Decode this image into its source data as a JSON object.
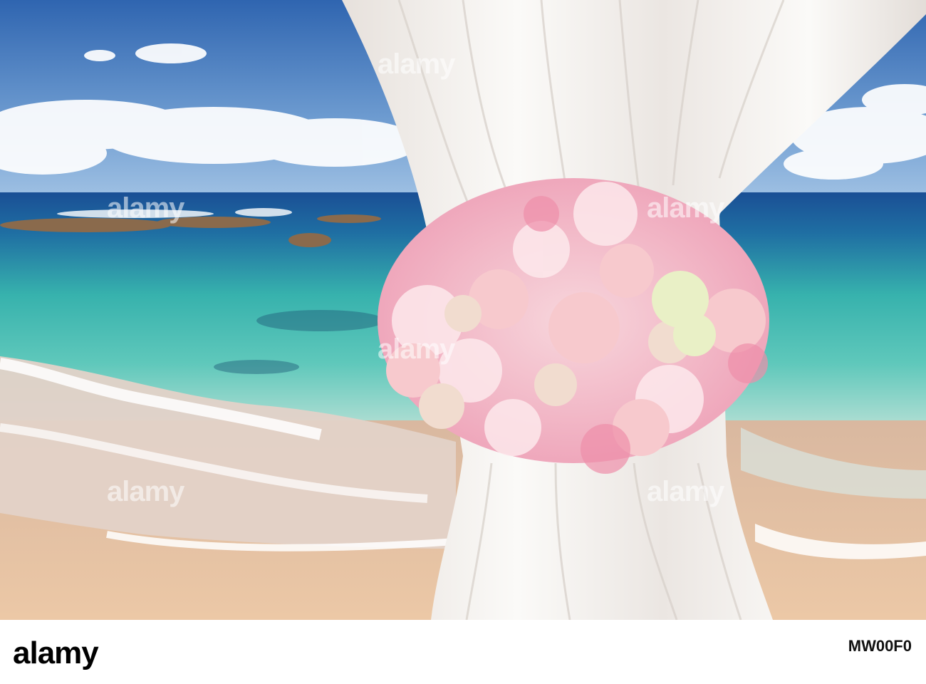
{
  "footer": {
    "brand": "alamy",
    "image_id_value": "MW00F0"
  },
  "watermarks": [
    "alamy",
    "alamy",
    "alamy",
    "alamy",
    "alamy",
    "alamy"
  ],
  "colors": {
    "sky": "#3f74b8",
    "sea_deep": "#1f5fa0",
    "sea_turquoise": "#3fc0b0",
    "sand": "#e6c6a8",
    "curtain": "#f4f2ef",
    "flowers_pink": "#f2b7c7"
  }
}
